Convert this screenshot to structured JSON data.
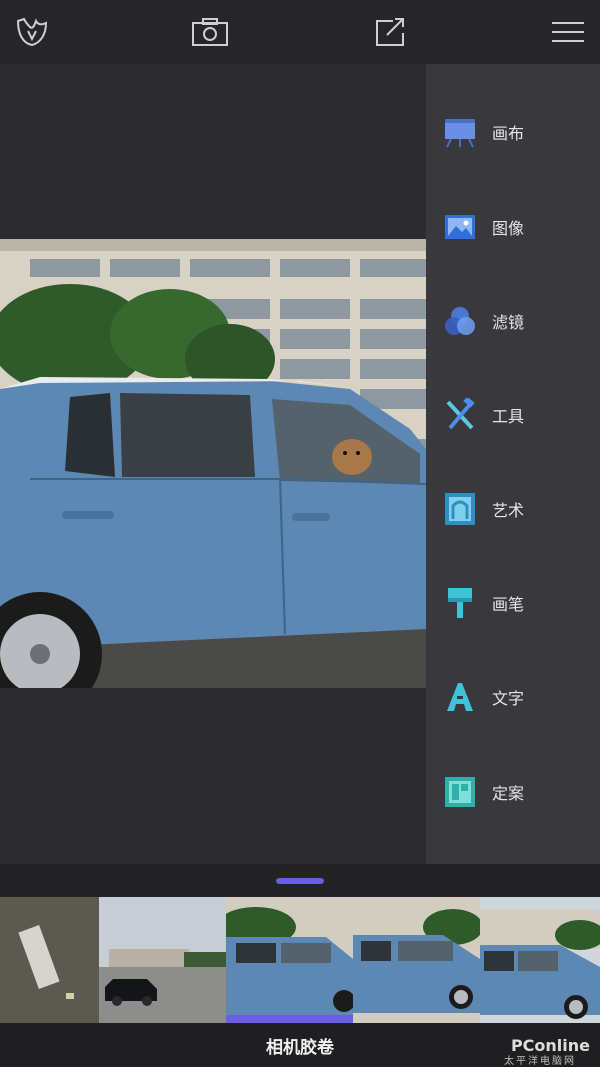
{
  "toolbar": {
    "icons": [
      "app-logo-icon",
      "camera-icon",
      "share-icon",
      "menu-icon"
    ]
  },
  "side_menu": {
    "items": [
      {
        "label": "画布",
        "icon": "canvas-easel-icon"
      },
      {
        "label": "图像",
        "icon": "image-icon"
      },
      {
        "label": "滤镜",
        "icon": "filter-icon"
      },
      {
        "label": "工具",
        "icon": "tools-icon"
      },
      {
        "label": "艺术",
        "icon": "art-frame-icon"
      },
      {
        "label": "画笔",
        "icon": "brush-icon"
      },
      {
        "label": "文字",
        "icon": "text-icon"
      },
      {
        "label": "定案",
        "icon": "finalize-icon"
      }
    ]
  },
  "filmstrip": {
    "caption": "相机胶卷",
    "selected_index": 2
  },
  "watermark": {
    "brand": "PConline",
    "sub": "太平洋电脑网"
  },
  "colors": {
    "accent": "#6a5fe0",
    "icon_blue": "#4a8ee8",
    "icon_teal": "#3fc3d6"
  }
}
